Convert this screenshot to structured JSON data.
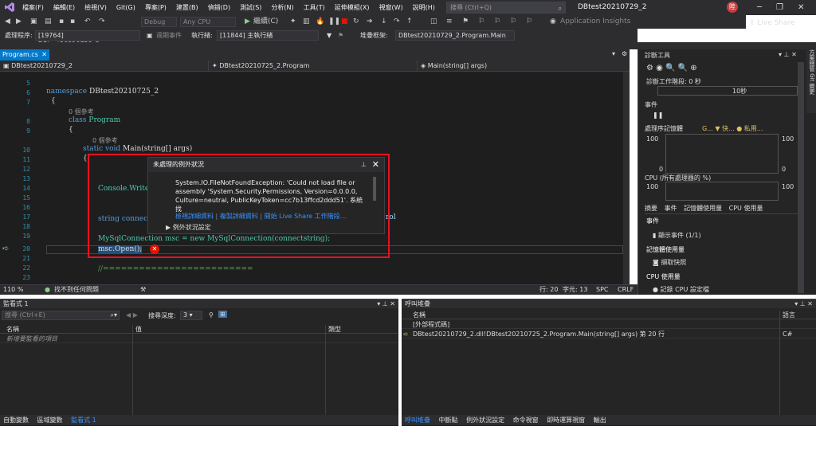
{
  "menu": {
    "items": [
      "檔案(F)",
      "編輯(E)",
      "檢視(V)",
      "Git(G)",
      "專案(P)",
      "建置(B)",
      "偵錯(D)",
      "測試(S)",
      "分析(N)",
      "工具(T)",
      "延伸模組(X)",
      "視窗(W)",
      "說明(H)"
    ],
    "search_placeholder": "搜尋 (Ctrl+Q)",
    "solution_title": "DBtest20210729_2",
    "avatar_text": "陸"
  },
  "toolbar": {
    "config": "Debug",
    "platform": "Any CPU",
    "continue_label": "繼續(C)",
    "insights_label": "Application Insights",
    "live_share": "Live Share"
  },
  "debugbar": {
    "process_label": "處理程序:",
    "process_value": "[19764] DBtest20210729_2.exe",
    "lifecycle_label": "週期事件",
    "thread_label": "執行緒:",
    "thread_value": "[11844] 主執行緒",
    "stack_label": "堆疊框架:",
    "stack_value": "DBtest20210729_2.Program.Main"
  },
  "editor": {
    "tab_name": "Program.cs",
    "nav_project": "DBtest20210729_2",
    "nav_class": "DBtest20210725_2.Program",
    "nav_member": "Main(string[] args)",
    "line_numbers": [
      "5",
      "6",
      "7",
      "",
      "8",
      "9",
      "",
      "10",
      "11",
      "12",
      "13",
      "14",
      "15",
      "16",
      "17",
      "18",
      "19",
      "20",
      "21",
      "22",
      "23"
    ],
    "ns_kw": "namespace",
    "ns_name": "DBtest20210725_2",
    "brace_open": "{",
    "ref0": "0 個參考",
    "class_kw": "class",
    "class_name": "Program",
    "brace_open2": "{",
    "ref1": "0 個參考",
    "main_kw": "static void",
    "main_sig": "Main(string[] args)",
    "brace_open3": "{",
    "console_line": "Console.Write",
    "string_line": "string connec",
    "rol_tail": "rol",
    "mysql_line": "MySqlConnection msc = new MySqlConnection(connectstring);",
    "open_line": "msc.Open();",
    "comment_line": "//========================="
  },
  "exception": {
    "title": "未處理的例外狀況",
    "message": "System.IO.FileNotFoundException: 'Could not load file or assembly 'System.Security.Permissions, Version=0.0.0.0, Culture=neutral, PublicKeyToken=cc7b13ffcd2ddd51'. 系統找",
    "link1": "檢視詳細資料",
    "link2": "複製詳細資料",
    "link3": "開始 Live Share 工作階段...",
    "settings": "例外狀況設定"
  },
  "status": {
    "zoom": "110 %",
    "issues": "找不到任何問題",
    "line": "行: 20",
    "col": "字元: 13",
    "spc": "SPC",
    "crlf": "CRLF"
  },
  "diag": {
    "title": "診斷工具",
    "session": "診斷工作階段: 0 秒",
    "tick": "10秒",
    "events": "事件",
    "memory": "處理序記憶體",
    "mem_legend": "G... ▼ 快... ● 私用...",
    "y_top_left": "100",
    "y_top_right": "100",
    "y_bot_left": "0",
    "y_bot_right": "0",
    "cpu": "CPU (所有處理器的 %)",
    "cpu_top_left": "100",
    "cpu_top_right": "100",
    "tabs": [
      "摘要",
      "事件",
      "記憶體使用量",
      "CPU 使用量"
    ],
    "sec_events": "事件",
    "show_events": "顯示事件 (1/1)",
    "sec_mem": "記憶體使用量",
    "snapshot": "擷取快照",
    "sec_cpu": "CPU 使用量",
    "cpu_profile": "記錄 CPU 設定檔"
  },
  "watch": {
    "title": "監看式 1",
    "search_placeholder": "搜尋 (Ctrl+E)",
    "depth_label": "搜尋深度:",
    "depth_value": "3",
    "col_name": "名稱",
    "col_value": "值",
    "col_type": "類型",
    "new_item": "新增要監看的項目",
    "tabs": [
      "自動變數",
      "區域變數",
      "監看式 1"
    ]
  },
  "callstack": {
    "title": "呼叫堆疊",
    "col_name": "名稱",
    "col_lang": "語言",
    "rows": [
      {
        "name": "[外部程式碼]",
        "lang": ""
      },
      {
        "name": "DBtest20210729_2.dll!DBtest20210725_2.Program.Main(string[] args) 第 20 行",
        "lang": "C#"
      }
    ],
    "tabs": [
      "呼叫堆疊",
      "中斷點",
      "例外狀況設定",
      "命令視窗",
      "即時運算視窗",
      "輸出"
    ]
  },
  "right_strip": "方案總管 Git 變更"
}
